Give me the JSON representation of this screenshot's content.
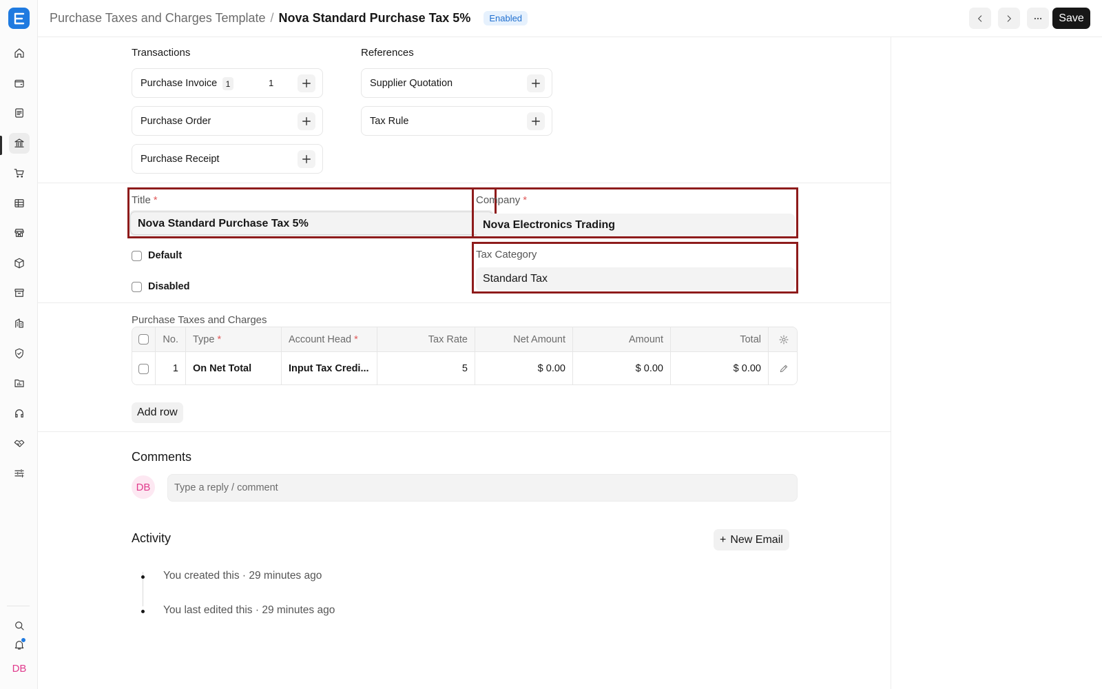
{
  "header": {
    "breadcrumb_parent": "Purchase Taxes and Charges Template",
    "breadcrumb_sep": "/",
    "breadcrumb_current": "Nova Standard Purchase Tax 5%",
    "status_badge": "Enabled",
    "save_label": "Save"
  },
  "sidebar": {
    "items": [
      "home-icon",
      "wallet-icon",
      "file-text-icon",
      "bank-icon",
      "cart-icon",
      "table-icon",
      "store-icon",
      "box-icon",
      "archive-icon",
      "building-icon",
      "shield-icon",
      "folder-chart-icon",
      "headset-icon",
      "handshake-icon",
      "sliders-icon"
    ],
    "active_item": "bank-icon",
    "avatar_initials": "DB"
  },
  "connections": {
    "transactions_label": "Transactions",
    "references_label": "References",
    "transactions": [
      {
        "label": "Purchase Invoice",
        "badge": "1",
        "count": "1"
      },
      {
        "label": "Purchase Order"
      },
      {
        "label": "Purchase Receipt"
      }
    ],
    "references": [
      {
        "label": "Supplier Quotation"
      },
      {
        "label": "Tax Rule"
      }
    ]
  },
  "form": {
    "title_label": "Title",
    "title_value": "Nova Standard Purchase Tax 5%",
    "company_label": "Company",
    "company_value": "Nova Electronics Trading",
    "tax_category_label": "Tax Category",
    "tax_category_value": "Standard Tax",
    "default_label": "Default",
    "disabled_label": "Disabled",
    "required_mark": "*"
  },
  "taxes_table": {
    "title": "Purchase Taxes and Charges",
    "columns": [
      "No.",
      "Type",
      "Account Head",
      "Tax Rate",
      "Net Amount",
      "Amount",
      "Total"
    ],
    "rows": [
      {
        "no": "1",
        "type": "On Net Total",
        "account_head": "Input Tax Credi...",
        "tax_rate": "5",
        "net_amount": "$ 0.00",
        "amount": "$ 0.00",
        "total": "$ 0.00"
      }
    ],
    "add_row_label": "Add row"
  },
  "comments": {
    "heading": "Comments",
    "avatar_initials": "DB",
    "placeholder": "Type a reply / comment"
  },
  "activity": {
    "heading": "Activity",
    "new_email_label": "New Email",
    "new_email_prefix": "+",
    "items": [
      "You created this · 29 minutes ago",
      "You last edited this · 29 minutes ago"
    ]
  },
  "colors": {
    "accent": "#1f7ae0",
    "highlight_border": "#8e1b1b",
    "avatar_pink": "#e03a8c"
  }
}
